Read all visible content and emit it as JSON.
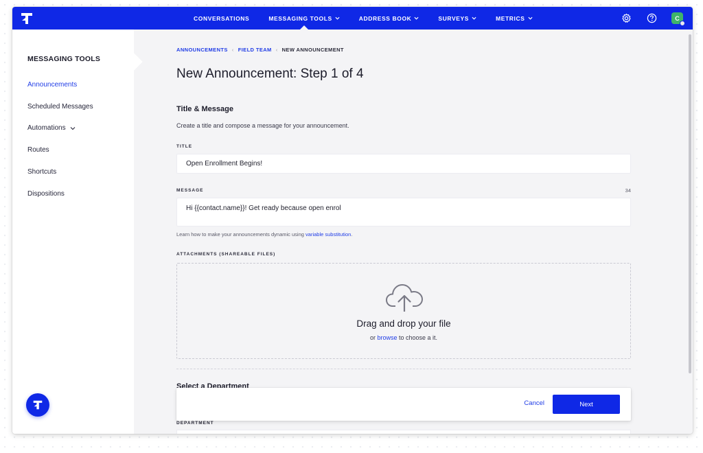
{
  "colors": {
    "brand": "#0f28e6",
    "link": "#1f3ce6",
    "background": "#f4f4f6",
    "avatar": "#3fb46a"
  },
  "topnav": {
    "logo_icon": "t-logo-icon",
    "items": [
      {
        "label": "CONVERSATIONS",
        "has_dropdown": false
      },
      {
        "label": "MESSAGING TOOLS",
        "has_dropdown": true,
        "active": true
      },
      {
        "label": "ADDRESS BOOK",
        "has_dropdown": true
      },
      {
        "label": "SURVEYS",
        "has_dropdown": true
      },
      {
        "label": "METRICS",
        "has_dropdown": true
      }
    ],
    "icons": [
      "gear-icon",
      "help-icon"
    ],
    "avatar_initial": "C"
  },
  "sidebar": {
    "title": "MESSAGING TOOLS",
    "items": [
      {
        "label": "Announcements",
        "active": true
      },
      {
        "label": "Scheduled Messages"
      },
      {
        "label": "Automations",
        "has_dropdown": true
      },
      {
        "label": "Routes"
      },
      {
        "label": "Shortcuts"
      },
      {
        "label": "Dispositions"
      }
    ]
  },
  "breadcrumb": {
    "items": [
      "ANNOUNCEMENTS",
      "FIELD TEAM"
    ],
    "current": "NEW ANNOUNCEMENT"
  },
  "page": {
    "title": "New Announcement: Step 1 of 4",
    "section_title": "Title & Message",
    "section_desc": "Create a title and compose a message for your announcement."
  },
  "form": {
    "title_label": "TITLE",
    "title_value": "Open Enrollment Begins!",
    "message_label": "MESSAGE",
    "message_count": "34",
    "message_value": "Hi {{contact.name}}! Get ready because open enrol",
    "helper_text": "Learn how to make your announcements dynamic using ",
    "helper_link": "variable substitution",
    "helper_end": ".",
    "attachments_label": "ATTACHMENTS (SHAREABLE FILES)",
    "drop_title": "Drag and drop your file",
    "drop_sub_prefix": "or ",
    "drop_browse": "browse",
    "drop_sub_suffix": " to choose a it.",
    "department_title": "Select a Department",
    "department_label": "DEPARTMENT"
  },
  "actions": {
    "cancel_label": "Cancel",
    "next_label": "Next"
  }
}
